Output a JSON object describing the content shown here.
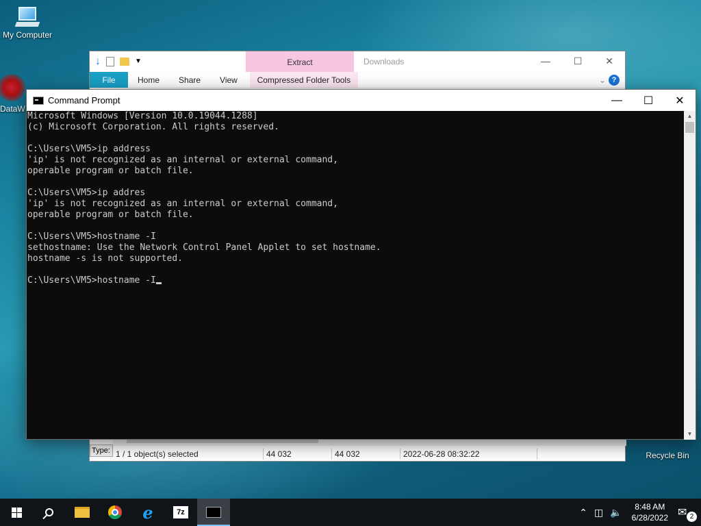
{
  "desktop": {
    "icons": [
      {
        "label": "My Computer"
      },
      {
        "label": "DataW"
      },
      {
        "label": "Recycle Bin"
      }
    ]
  },
  "explorer": {
    "title": "Downloads",
    "extract_label": "Extract",
    "tabs": [
      "File",
      "Home",
      "Share",
      "View"
    ],
    "contextual_tab": "Compressed Folder Tools",
    "type_label": "Type:",
    "status": {
      "selected": "1 / 1 object(s) selected",
      "size1": "44 032",
      "size2": "44 032",
      "datetime": "2022-06-28 08:32:22"
    },
    "colors": {
      "file_tab": "#19a0c6",
      "extract": "#f7c6e0"
    }
  },
  "cmd": {
    "title": "Command Prompt",
    "lines": [
      "Microsoft Windows [Version 10.0.19044.1288]",
      "(c) Microsoft Corporation. All rights reserved.",
      "",
      "C:\\Users\\VM5>ip address",
      "'ip' is not recognized as an internal or external command,",
      "operable program or batch file.",
      "",
      "C:\\Users\\VM5>ip addres",
      "'ip' is not recognized as an internal or external command,",
      "operable program or batch file.",
      "",
      "C:\\Users\\VM5>hostname -I",
      "sethostname: Use the Network Control Panel Applet to set hostname.",
      "hostname -s is not supported.",
      "",
      "C:\\Users\\VM5>hostname -I"
    ]
  },
  "taskbar": {
    "apps": [
      "start-icon",
      "search-icon",
      "file-explorer-icon",
      "chrome-icon",
      "internet-explorer-icon",
      "7zip-icon",
      "command-prompt-icon"
    ],
    "zip_label": "7z",
    "time": "8:48 AM",
    "date": "6/28/2022",
    "notification_count": "2"
  }
}
